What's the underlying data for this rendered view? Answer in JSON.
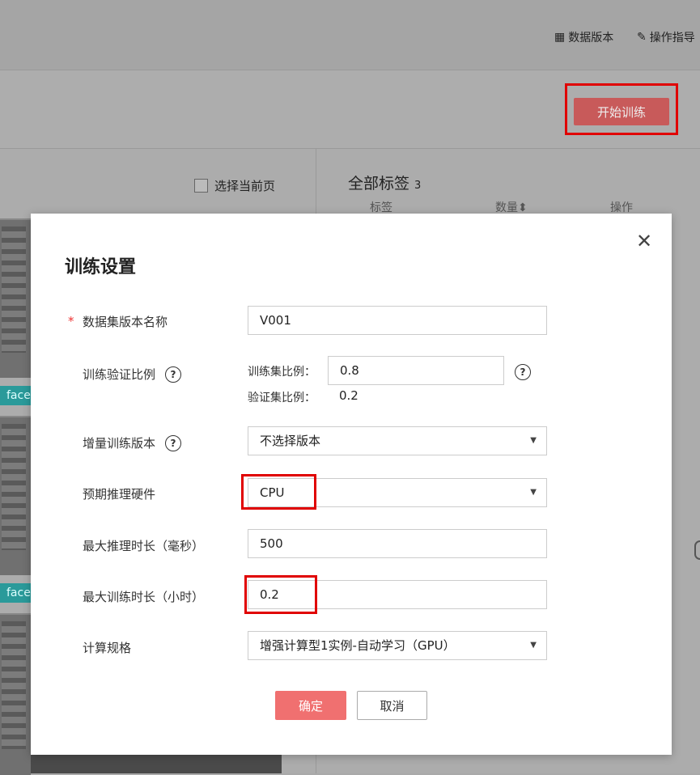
{
  "header": {
    "data_version_label": "数据版本",
    "guide_label": "操作指导"
  },
  "toolbar": {
    "start_training_label": "开始训练"
  },
  "gallery": {
    "select_page_label": "选择当前页",
    "face_tags": [
      "face",
      "face"
    ]
  },
  "labels_panel": {
    "title": "全部标签",
    "count": "3",
    "columns": [
      "标签",
      "数量",
      "操作"
    ],
    "sort_icon": "sort-icon"
  },
  "dialog": {
    "title": "训练设置",
    "close_icon": "close-icon",
    "dataset_version_name": {
      "label": "数据集版本名称",
      "required_mark": "*",
      "value": "V001"
    },
    "split_ratio": {
      "label": "训练验证比例",
      "help": "?",
      "train_label": "训练集比例：",
      "train_value": "0.8",
      "val_label": "验证集比例：",
      "val_value": "0.2"
    },
    "incremental_version": {
      "label": "增量训练版本",
      "help": "?",
      "value": "不选择版本"
    },
    "inference_hardware": {
      "label": "预期推理硬件",
      "value": "CPU"
    },
    "max_inference_time": {
      "label": "最大推理时长（毫秒）",
      "value": "500"
    },
    "max_training_time": {
      "label": "最大训练时长（小时）",
      "value": "0.2"
    },
    "compute_spec": {
      "label": "计算规格",
      "value": "增强计算型1实例-自动学习（GPU）"
    },
    "ok_label": "确定",
    "cancel_label": "取消"
  },
  "colors": {
    "primary": "#f07070",
    "highlight": "#e00000",
    "tag": "#2a9a9a"
  }
}
